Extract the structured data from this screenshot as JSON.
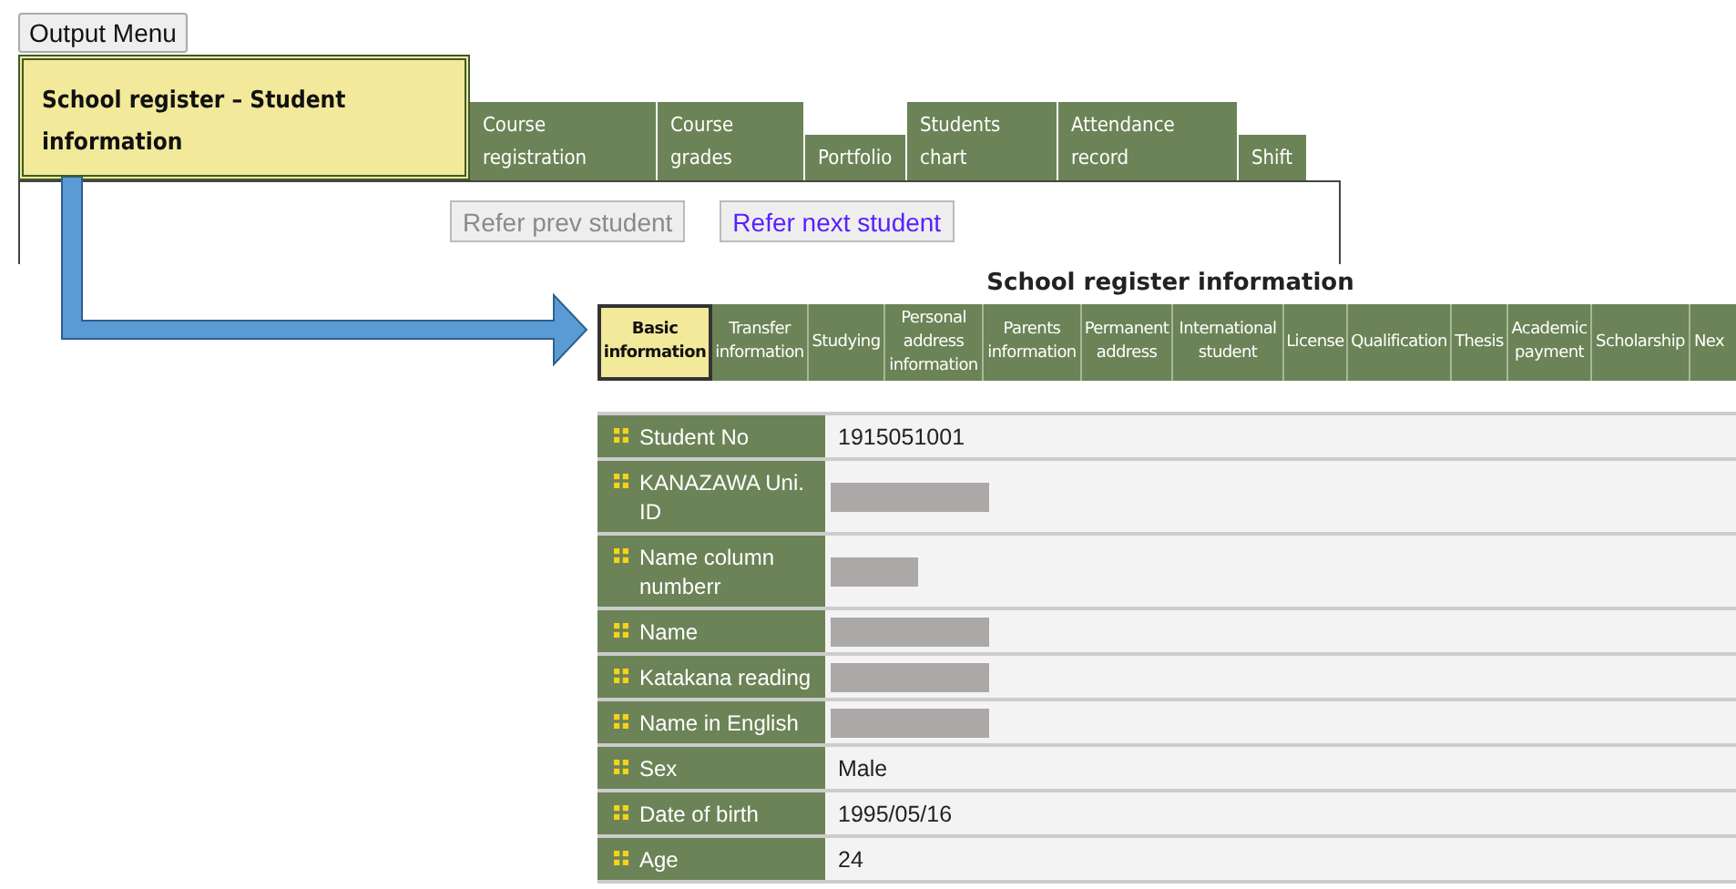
{
  "output_menu_button": "Output Menu",
  "main_tabs": [
    {
      "label": "School register – Student information",
      "selected": true
    },
    {
      "label": "Course registration",
      "selected": false
    },
    {
      "label": "Course grades",
      "selected": false
    },
    {
      "label": "Portfolio",
      "selected": false
    },
    {
      "label": "Students chart",
      "selected": false
    },
    {
      "label": "Attendance record",
      "selected": false
    },
    {
      "label": "Shift",
      "selected": false
    }
  ],
  "nav_buttons": [
    {
      "label": "Refer prev student",
      "disabled": true
    },
    {
      "label": "Refer next student",
      "disabled": false
    }
  ],
  "section_title": "School register information",
  "sub_tabs": [
    {
      "label": "Basic information",
      "selected": true
    },
    {
      "label": "Transfer information",
      "selected": false
    },
    {
      "label": "Studying",
      "selected": false
    },
    {
      "label": "Personal address information",
      "selected": false
    },
    {
      "label": "Parents information",
      "selected": false
    },
    {
      "label": "Permanent address",
      "selected": false
    },
    {
      "label": "International student",
      "selected": false
    },
    {
      "label": "License",
      "selected": false
    },
    {
      "label": "Qualification",
      "selected": false
    },
    {
      "label": "Thesis",
      "selected": false
    },
    {
      "label": "Academic payment",
      "selected": false
    },
    {
      "label": "Scholarship",
      "selected": false
    },
    {
      "label": "Nex",
      "selected": false
    }
  ],
  "fields": [
    {
      "label": "Student No",
      "value": "1915051001"
    },
    {
      "label": "KANAZAWA Uni. ID",
      "redacted": true,
      "short": false
    },
    {
      "label": "Name column numberr",
      "redacted": true,
      "short": true
    },
    {
      "label": "Name",
      "redacted": true,
      "short": false
    },
    {
      "label": "Katakana reading",
      "redacted": true,
      "short": false
    },
    {
      "label": "Name in English",
      "redacted": true,
      "short": false
    },
    {
      "label": "Sex",
      "value": "Male"
    },
    {
      "label": "Date of birth",
      "value": "1995/05/16"
    },
    {
      "label": "Age",
      "value": "24"
    }
  ]
}
